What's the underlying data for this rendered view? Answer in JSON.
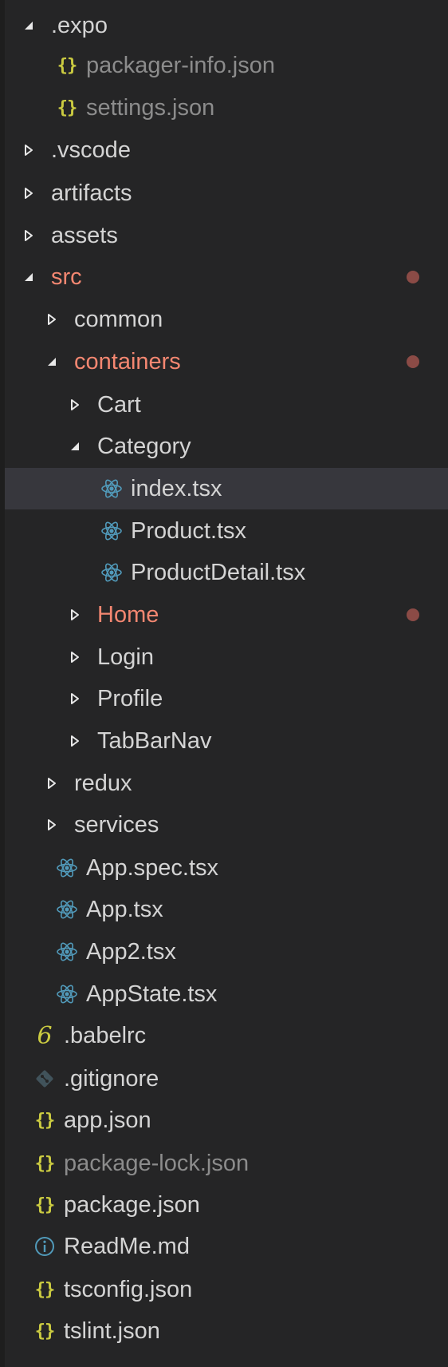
{
  "colors": {
    "background": "#252526",
    "selection": "#37373d",
    "text": "#d4d4d4",
    "ignored_text": "#8c8c8c",
    "modified_text": "#f48771",
    "modified_dot": "#8b4b46",
    "json_icon": "#cbcb41",
    "react_icon": "#519aba",
    "info_icon": "#519aba",
    "git_icon": "#41535b"
  },
  "tree": [
    {
      "label": ".expo",
      "kind": "folder",
      "expanded": true
    },
    {
      "label": "packager-info.json",
      "kind": "file",
      "icon": "json-icon",
      "status": "ignored"
    },
    {
      "label": "settings.json",
      "kind": "file",
      "icon": "json-icon",
      "status": "ignored"
    },
    {
      "label": ".vscode",
      "kind": "folder",
      "expanded": false
    },
    {
      "label": "artifacts",
      "kind": "folder",
      "expanded": false
    },
    {
      "label": "assets",
      "kind": "folder",
      "expanded": false
    },
    {
      "label": "src",
      "kind": "folder",
      "expanded": true,
      "status": "modified"
    },
    {
      "label": "common",
      "kind": "folder",
      "expanded": false
    },
    {
      "label": "containers",
      "kind": "folder",
      "expanded": true,
      "status": "modified"
    },
    {
      "label": "Cart",
      "kind": "folder",
      "expanded": false
    },
    {
      "label": "Category",
      "kind": "folder",
      "expanded": true
    },
    {
      "label": "index.tsx",
      "kind": "file",
      "icon": "react-icon",
      "selected": true
    },
    {
      "label": "Product.tsx",
      "kind": "file",
      "icon": "react-icon"
    },
    {
      "label": "ProductDetail.tsx",
      "kind": "file",
      "icon": "react-icon"
    },
    {
      "label": "Home",
      "kind": "folder",
      "expanded": false,
      "status": "modified"
    },
    {
      "label": "Login",
      "kind": "folder",
      "expanded": false
    },
    {
      "label": "Profile",
      "kind": "folder",
      "expanded": false
    },
    {
      "label": "TabBarNav",
      "kind": "folder",
      "expanded": false
    },
    {
      "label": "redux",
      "kind": "folder",
      "expanded": false
    },
    {
      "label": "services",
      "kind": "folder",
      "expanded": false
    },
    {
      "label": "App.spec.tsx",
      "kind": "file",
      "icon": "react-icon"
    },
    {
      "label": "App.tsx",
      "kind": "file",
      "icon": "react-icon"
    },
    {
      "label": "App2.tsx",
      "kind": "file",
      "icon": "react-icon"
    },
    {
      "label": "AppState.tsx",
      "kind": "file",
      "icon": "react-icon"
    },
    {
      "label": ".babelrc",
      "kind": "file",
      "icon": "babel-icon"
    },
    {
      "label": ".gitignore",
      "kind": "file",
      "icon": "git-icon"
    },
    {
      "label": "app.json",
      "kind": "file",
      "icon": "json-icon"
    },
    {
      "label": "package-lock.json",
      "kind": "file",
      "icon": "json-icon",
      "status": "ignored"
    },
    {
      "label": "package.json",
      "kind": "file",
      "icon": "json-icon"
    },
    {
      "label": "ReadMe.md",
      "kind": "file",
      "icon": "info-icon"
    },
    {
      "label": "tsconfig.json",
      "kind": "file",
      "icon": "json-icon"
    },
    {
      "label": "tslint.json",
      "kind": "file",
      "icon": "json-icon"
    }
  ]
}
